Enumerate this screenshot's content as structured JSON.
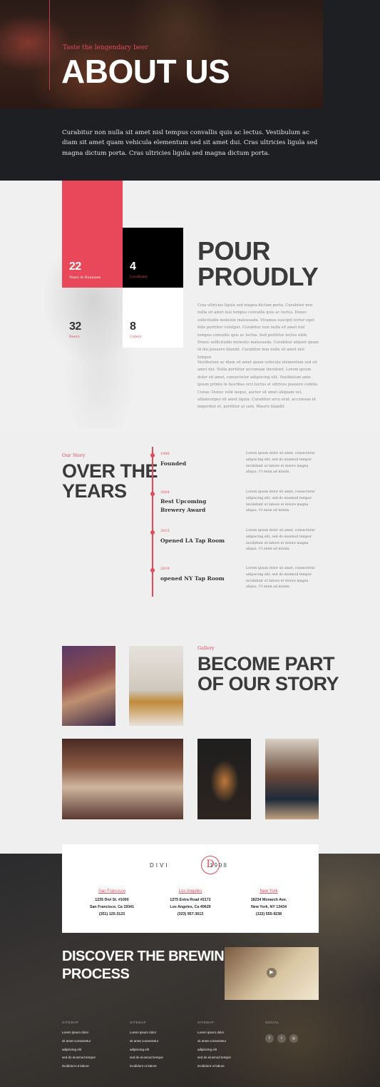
{
  "hero": {
    "tagline": "Taste the lengendary beer",
    "title": "ABOUT US",
    "text": "Curabitur non nulla sit amet nisl tempus convallis quis ac lectus. Vestibulum ac diam sit amet quam vehicula elementum sed sit amet dui. Cras ultricies ligula sed magna dictum porta. Cras ultricies ligula sed magna dictum porta."
  },
  "stats": [
    {
      "num": "22",
      "label": "Years in Business"
    },
    {
      "num": "4",
      "label": "Locations"
    },
    {
      "num": "32",
      "label": "Beers"
    },
    {
      "num": "8",
      "label": "Ciders"
    }
  ],
  "pour": {
    "title_line1": "POUR",
    "title_line2": "PROUDLY",
    "para1": "Cras ultricies ligula sed magna dictum porta. Curabitur non nulla sit amet nisl tempus convallis quis ac lectus. Donec sollicitudin molestie malesuada. Vivamus suscipit tortor eget felis porttitor volutpat. Curabitur non nulla sit amet nisl tempus convallis quis ac lectus. Sed porttitor lectus nibh. Donec sollicitudin molestie malesuada. Curabitur aliquet quam id dui posuere blandit. Curabitur non nulla sit amet nisl tempor.",
    "para2": "Vestibulum ac diam sit amet quam vehicula elementum sed sit amet dui. Nulla porttitor accumsan tincidunt. Lorem ipsum dolor sit amet, consectetur adipiscing elit. Vestibulum ante ipsum primis in faucibus orci luctus et ultrices posuere cubilia Curae; Donec velit neque, auctor sit amet aliquam vel, ullamcorper sit amet ligula. Curabitur arcu erat, accumsan id imperdiet et, porttitor at sem. Mauris blandit"
  },
  "story": {
    "tag": "Our Story",
    "title_line1": "OVER THE",
    "title_line2": "YEARS",
    "events": [
      {
        "year": "1998",
        "title": "Founded",
        "desc": "Lorem ipsum dolor sit amet, consectetur adipiscing elit, sed do eiusmod tempor incididunt ut labore et dolore magna aliqua. Ut enim ad minim."
      },
      {
        "year": "2004",
        "title": "Best Upcoming Brewery Award",
        "desc": "Lorem ipsum dolor sit amet, consectetur adipiscing elit, sed do eiusmod tempor incididunt ut labore et dolore magna aliqua. Ut enim ad minim."
      },
      {
        "year": "2015",
        "title": "Opened LA Tap Room",
        "desc": "Lorem ipsum dolor sit amet, consectetur adipiscing elit, sed do eiusmod tempor incididunt ut labore et dolore magna aliqua. Ut enim ad minim."
      },
      {
        "year": "2019",
        "title": "opened NY Tap Room",
        "desc": "Lorem ipsum dolor sit amet, consectetur adipiscing elit, sed do eiusmod tempor incididunt ut labore et dolore magna aliqua. Ut enim ad minim."
      }
    ]
  },
  "gallery": {
    "tag": "Gallery",
    "title_line1": "BECOME PART",
    "title_line2": "OF OUR STORY"
  },
  "brand": {
    "left": "DIVI",
    "logo": "D",
    "right": "1998"
  },
  "locations": [
    {
      "city": "San Francisco",
      "street": "1235 Divi St. #1000",
      "citystate": "San Francisco, Ca 19341",
      "phone": "(351) 125-3123"
    },
    {
      "city": "Los Angeles",
      "street": "1275 Extra Road #2172",
      "citystate": "Los Angeles, Ca 40629",
      "phone": "(323) 957-3613"
    },
    {
      "city": "New York",
      "street": "18234 Monarch Ave.",
      "citystate": "New York, NY 13434",
      "phone": "(122) 555-9238"
    }
  ],
  "discover": {
    "title_line1": "DISCOVER THE BREWING",
    "title_line2": "PROCESS"
  },
  "footer": {
    "columns": [
      {
        "heading": "SITEMAP",
        "links": [
          "Lorem ipsum dolor",
          "sit amet consectetur",
          "adipiscing elit",
          "sed do eiusmod tempor",
          "incididunt ut labore"
        ]
      },
      {
        "heading": "SITEMAP",
        "links": [
          "Lorem ipsum dolor",
          "sit amet consectetur",
          "adipiscing elit",
          "sed do eiusmod tempor",
          "incididunt ut labore"
        ]
      },
      {
        "heading": "SITEMAP",
        "links": [
          "Lorem ipsum dolor",
          "sit amet consectetur",
          "adipiscing elit",
          "sed do eiusmod tempor",
          "incididunt ut labore"
        ]
      }
    ],
    "social_heading": "SOCIAL",
    "social": [
      {
        "icon": "facebook-icon",
        "glyph": "f"
      },
      {
        "icon": "twitter-icon",
        "glyph": "t"
      },
      {
        "icon": "instagram-icon",
        "glyph": "◎"
      }
    ]
  },
  "colors": {
    "accent": "#e04a5a",
    "dark": "#1e1f23",
    "light": "#efefef"
  }
}
